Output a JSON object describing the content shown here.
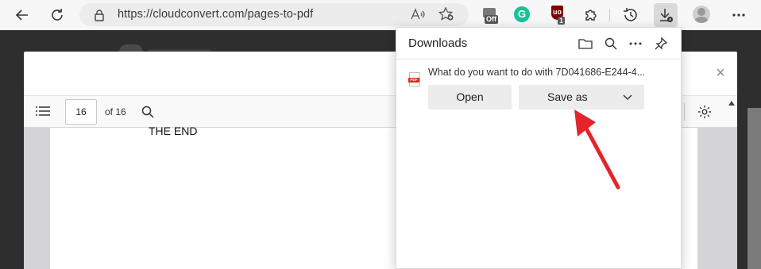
{
  "browser": {
    "url": "https://cloudconvert.com/pages-to-pdf",
    "extensions": {
      "off_badge": "Off",
      "grammarly_letter": "G",
      "ublock_letters": "uo",
      "ublock_count": "1"
    },
    "icons": [
      "back-arrow-icon",
      "refresh-icon",
      "lock-icon",
      "read-aloud-icon",
      "favorites-add-icon",
      "extensions-puzzle-icon",
      "history-icon",
      "downloads-icon",
      "profile-avatar",
      "more-menu-icon"
    ]
  },
  "viewer": {
    "page_current": "16",
    "page_total_label": "of 16",
    "pdf_text": "THE END"
  },
  "modal": {
    "close_glyph": "×"
  },
  "downloads": {
    "title": "Downloads",
    "message": "What do you want to do with 7D041686-E244-4...",
    "open_label": "Open",
    "save_as_label": "Save as",
    "file_type_tag": "PDF"
  },
  "colors": {
    "arrow": "#e3242b",
    "grammarly": "#15c39a",
    "ublock": "#800000"
  }
}
